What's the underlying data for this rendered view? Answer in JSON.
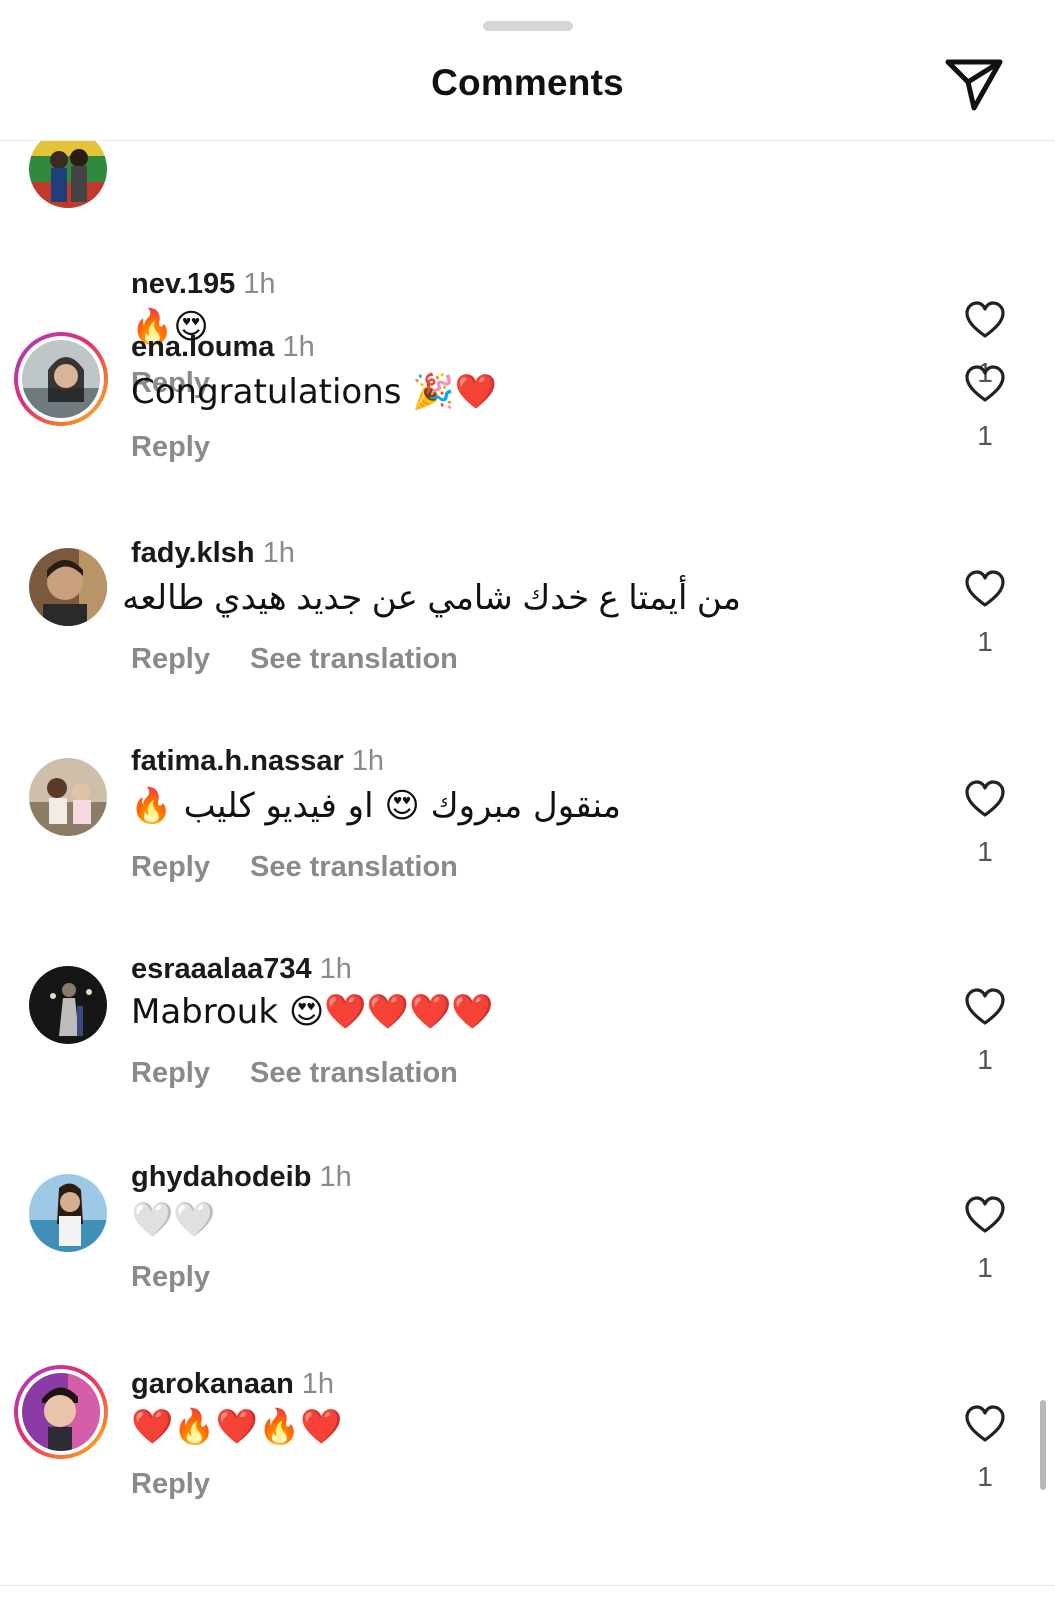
{
  "header": {
    "title": "Comments"
  },
  "comments": [
    {
      "username": "nev.195",
      "time": "1h",
      "text": "🔥😍",
      "reply_label": "Reply",
      "likes": "1"
    },
    {
      "username": "ena.louma",
      "time": "1h",
      "text": "Congratulations 🎉❤️",
      "reply_label": "Reply",
      "likes": "1"
    },
    {
      "username": "fady.klsh",
      "time": "1h",
      "text": "من أيمتا ع خدك شامي عن جديد هيدي طالعه",
      "reply_label": "Reply",
      "translate_label": "See translation",
      "likes": "1"
    },
    {
      "username": "fatima.h.nassar",
      "time": "1h",
      "text": "منقول مبروك 😍 او فيديو كليب 🔥",
      "reply_label": "Reply",
      "translate_label": "See translation",
      "likes": "1"
    },
    {
      "username": "esraaalaa734",
      "time": "1h",
      "text": "Mabrouk 😍❤️❤️❤️❤️",
      "reply_label": "Reply",
      "translate_label": "See translation",
      "likes": "1"
    },
    {
      "username": "ghydahodeib",
      "time": "1h",
      "text": "🤍🤍",
      "reply_label": "Reply",
      "likes": "1"
    },
    {
      "username": "garokanaan",
      "time": "1h",
      "text": "❤️🔥❤️🔥❤️",
      "reply_label": "Reply",
      "likes": "1"
    }
  ]
}
